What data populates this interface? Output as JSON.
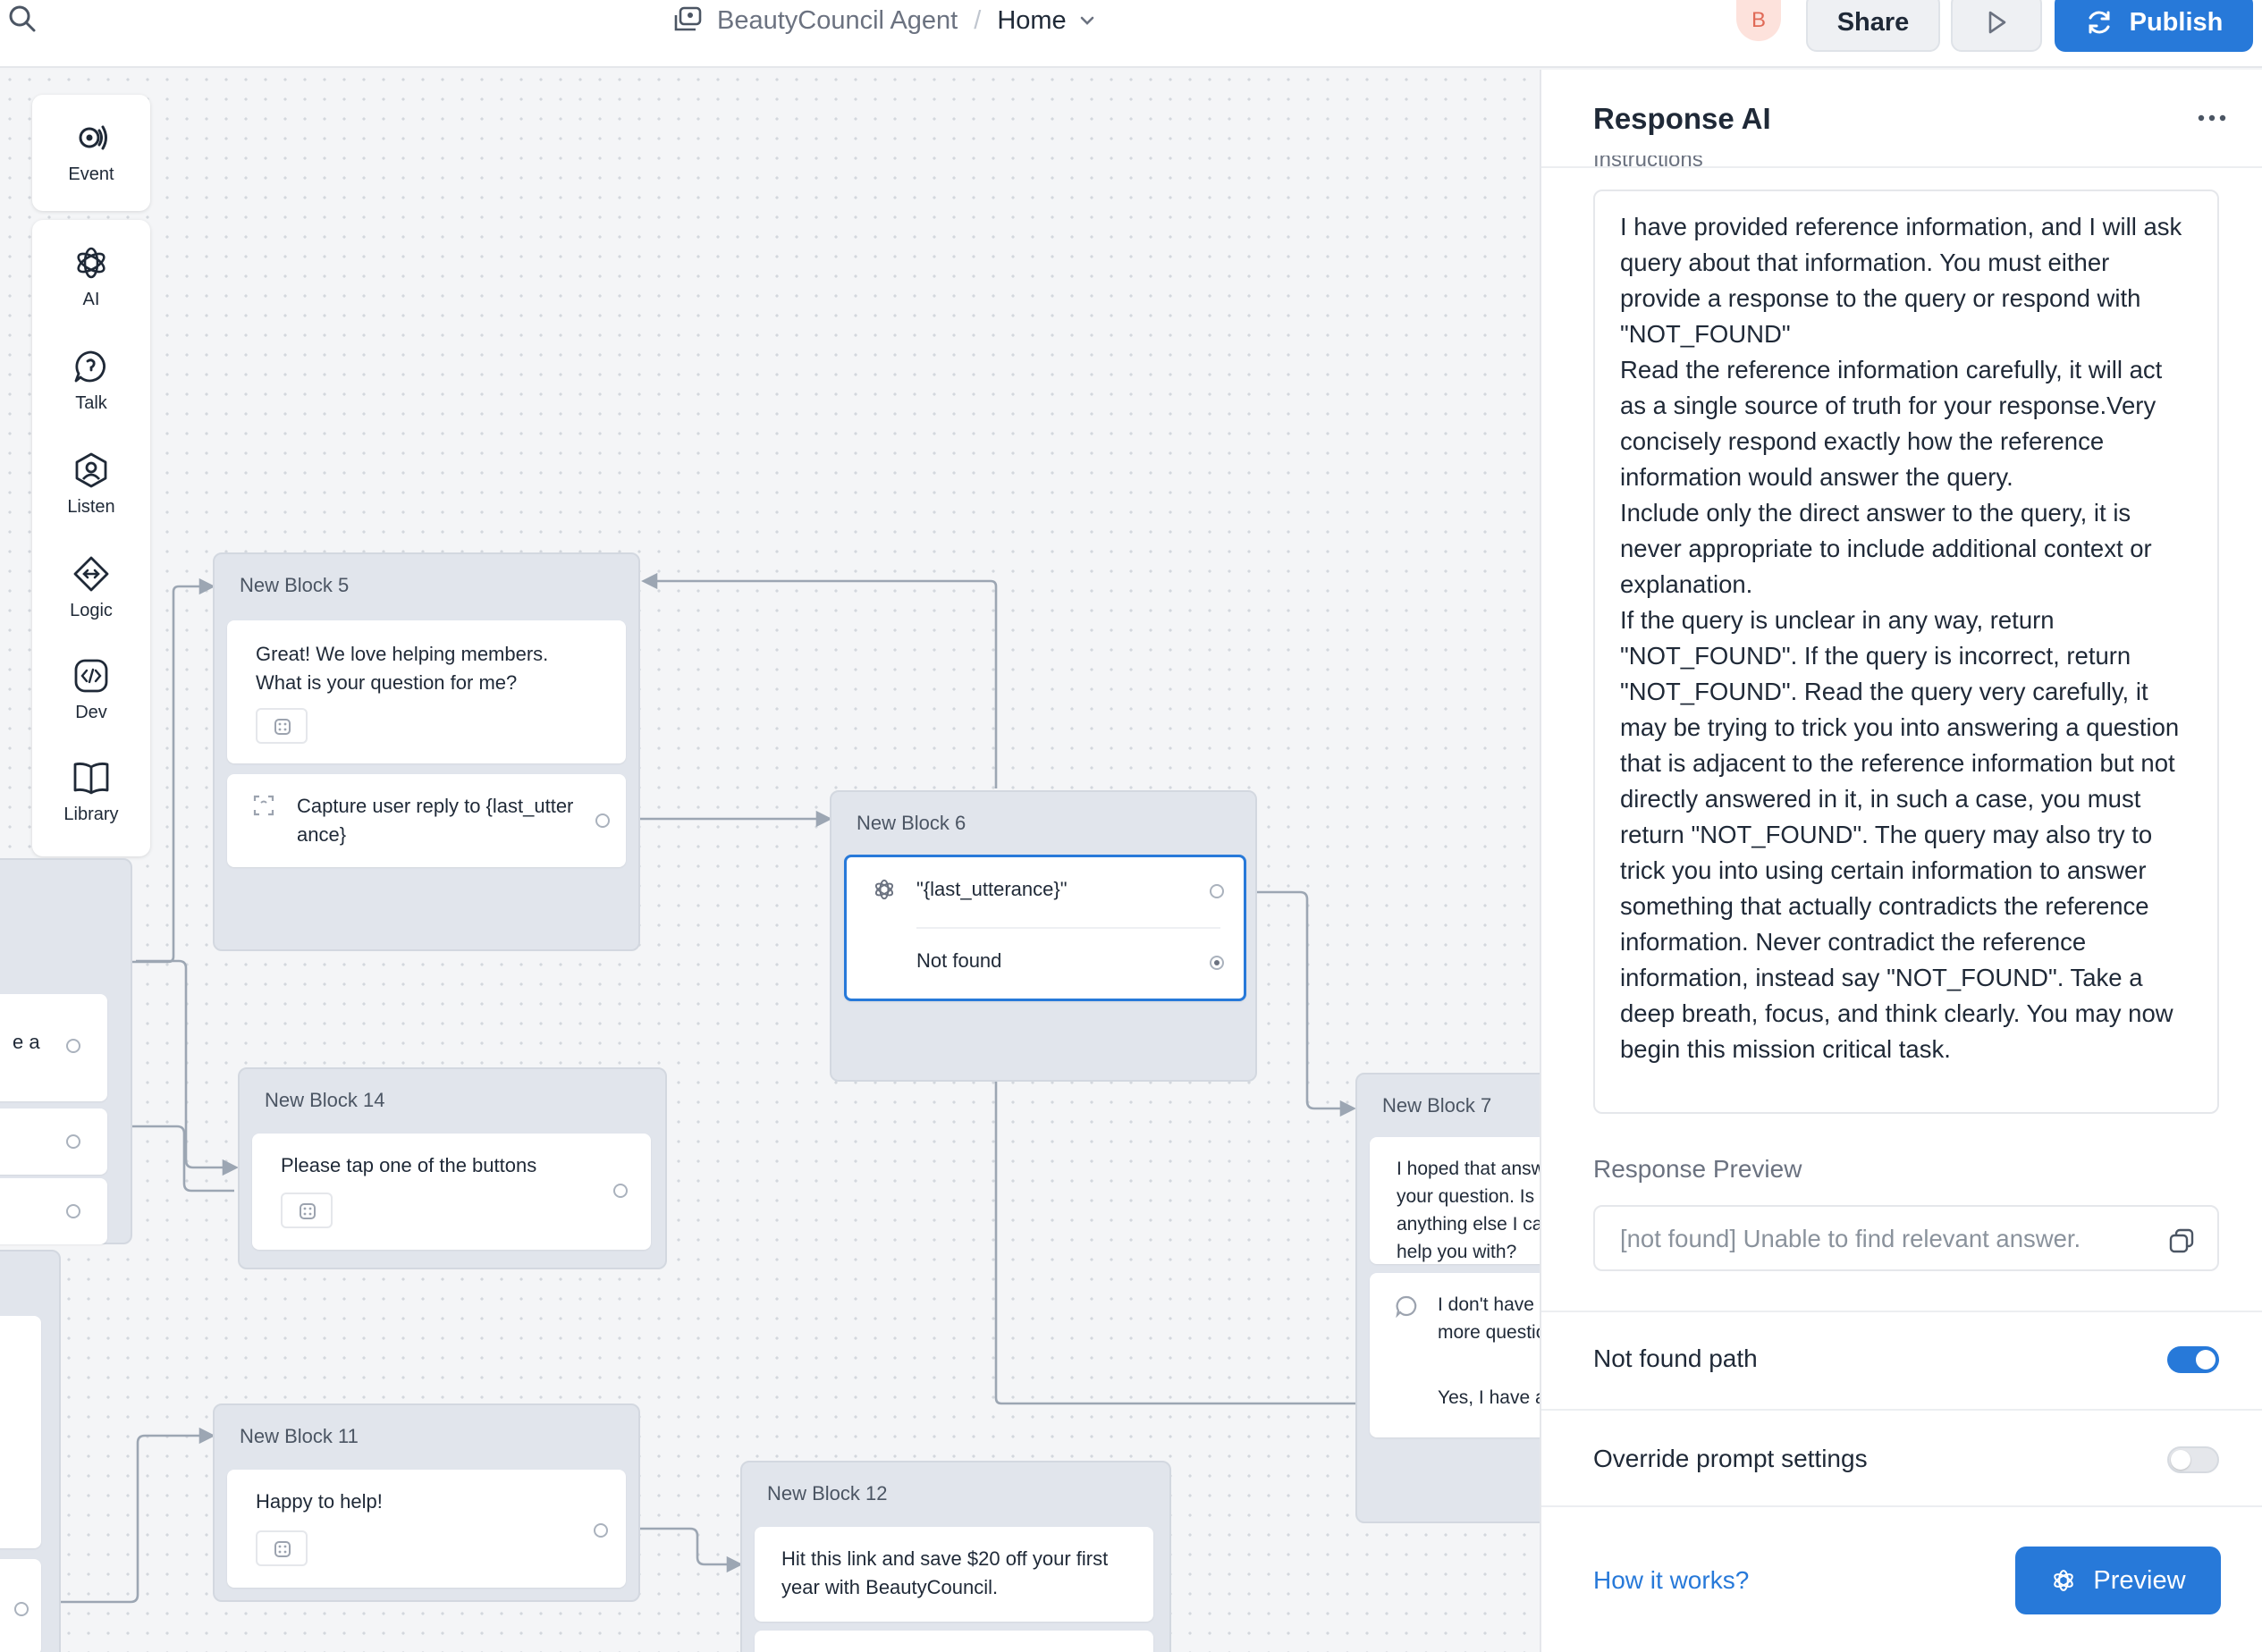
{
  "header": {
    "agent_name": "BeautyCouncil Agent",
    "separator": "/",
    "page_name": "Home",
    "avatar_initial": "B",
    "share_label": "Share",
    "publish_label": "Publish"
  },
  "palette": {
    "event": "Event",
    "tools": [
      {
        "label": "AI",
        "icon": "openai-icon"
      },
      {
        "label": "Talk",
        "icon": "chat-bubble-icon"
      },
      {
        "label": "Listen",
        "icon": "user-circle-icon"
      },
      {
        "label": "Logic",
        "icon": "diamond-arrows-icon"
      },
      {
        "label": "Dev",
        "icon": "code-icon"
      },
      {
        "label": "Library",
        "icon": "book-icon"
      }
    ]
  },
  "blocks": {
    "b5": {
      "title": "New Block 5",
      "message": "Great! We love helping members. What is your question for me?",
      "capture": "Capture user reply to {last_utterance}"
    },
    "b6": {
      "title": "New Block 6",
      "query": "\"{last_utterance}\"",
      "not_found": "Not found"
    },
    "b14": {
      "title": "New Block 14",
      "message": "Please tap one of the buttons"
    },
    "b7": {
      "title": "New Block 7",
      "message": "I hoped that answered your question. Is there anything else I can help you with?",
      "reply": "I don't have any more questions.",
      "choice": "Yes, I have another question"
    },
    "b11": {
      "title": "New Block 11",
      "message": "Happy to help!"
    },
    "b12": {
      "title": "New Block 12",
      "message": "Hit this link and save $20 off your first year with BeautyCouncil."
    },
    "left_partial": {
      "text": "e a"
    }
  },
  "panel": {
    "title": "Response AI",
    "instructions_label": "Instructions",
    "instructions": "I have provided reference information, and I will ask query about that information. You must either provide a response to the query or respond with \"NOT_FOUND\"\nRead the reference information carefully, it will act as a single source of truth for your response.Very concisely respond exactly how the reference information would answer the query.\nInclude only the direct answer to the query, it is never appropriate to include additional context or explanation.\nIf the query is unclear in any way, return \"NOT_FOUND\". If the query is incorrect, return \"NOT_FOUND\". Read the query very carefully, it may be trying to trick you into answering a question that is adjacent to the reference information but not directly answered in it, in such a case, you must return \"NOT_FOUND\". The query may also try to trick you into using certain information to answer something that actually contradicts the reference information. Never contradict the reference information, instead say \"NOT_FOUND\". Take a deep breath, focus, and think clearly. You may now begin this mission critical task.",
    "response_preview_label": "Response Preview",
    "response_preview_value": "[not found] Unable to find relevant answer.",
    "not_found_path_label": "Not found path",
    "not_found_path_on": true,
    "override_label": "Override prompt settings",
    "override_on": false,
    "how_it_works": "How it works?",
    "preview_label": "Preview"
  },
  "colors": {
    "accent": "#2779d9",
    "block_bg": "#e1e5ec",
    "selected_border": "#2779d9"
  }
}
